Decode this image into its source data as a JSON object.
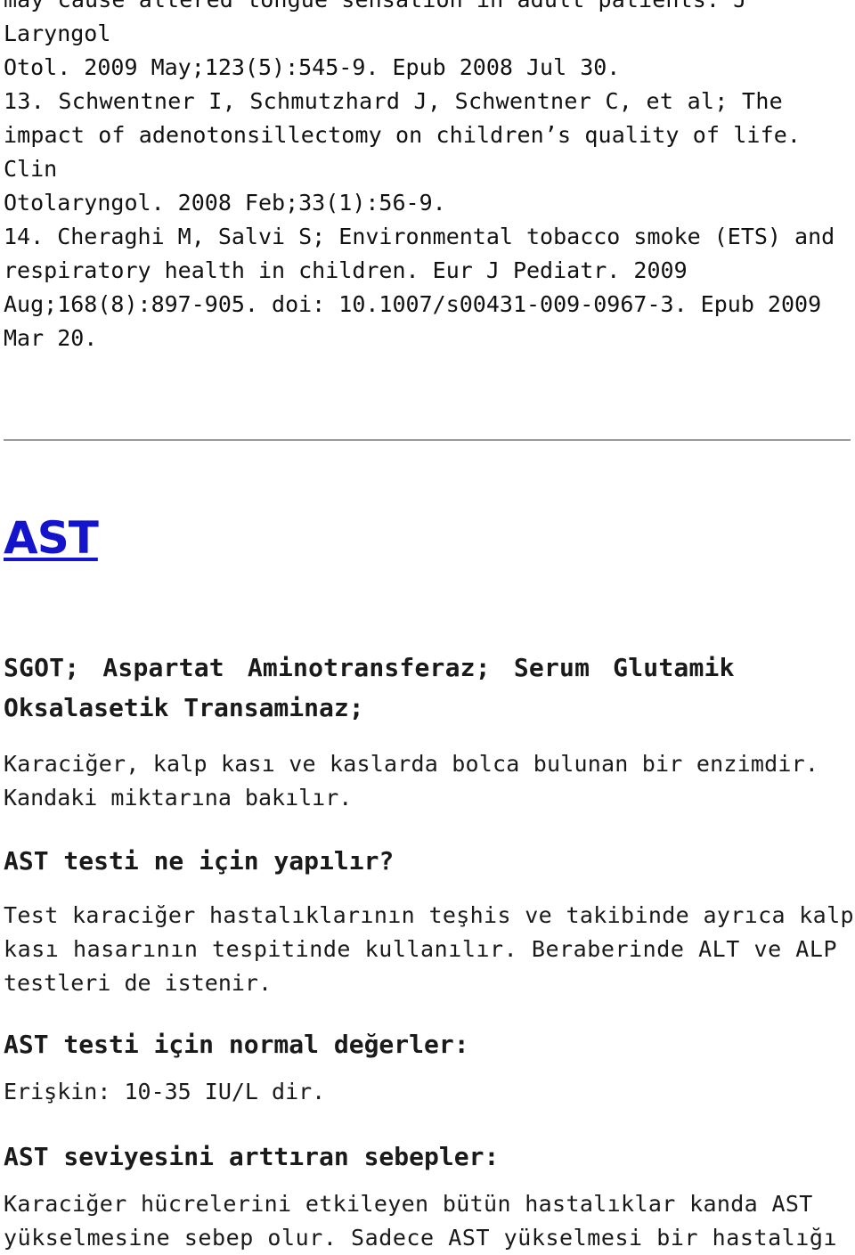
{
  "references": {
    "lines": [
      "may cause altered tongue sensation in adult patients. J",
      "Laryngol",
      "Otol. 2009 May;123(5):545-9. Epub 2008 Jul 30.",
      "13. Schwentner I, Schmutzhard J, Schwentner C, et al; The",
      "impact of adenotonsillectomy on children’s quality of life.",
      "Clin",
      "Otolaryngol. 2008 Feb;33(1):56-9.",
      "14. Cheraghi M, Salvi S; Environmental tobacco smoke (ETS) and",
      "respiratory health in children. Eur J Pediatr. 2009",
      "Aug;168(8):897-905. doi: 10.1007/s00431-009-0967-3. Epub 2009",
      "Mar 20."
    ]
  },
  "article": {
    "title_link": "AST",
    "link_color": "#1414cc",
    "subtitle_line1": "SGOT; Aspartat Aminotransferaz; Serum Glutamik",
    "subtitle_line2": "Oksalasetik Transaminaz;",
    "intro_line1": "Karaciğer, kalp kası ve kaslarda bolca bulunan bir enzimdir.",
    "intro_line2": "Kandaki miktarına bakılır.",
    "sections": [
      {
        "heading": "AST testi ne için yapılır?",
        "lines": [
          "Test karaciğer hastalıklarının teşhis ve takibinde ayrıca kalp",
          "kası hasarının tespitinde kullanılır. Beraberinde ALT ve ALP",
          "testleri de istenir."
        ]
      },
      {
        "heading": "AST testi için normal değerler:",
        "lines": [
          "Erişkin: 10-35 IU/L dir."
        ]
      },
      {
        "heading": "AST seviyesini arttıran sebepler:",
        "lines": [
          "Karaciğer hücrelerini etkileyen bütün hastalıklar kanda AST",
          "yükselmesine sebep olur. Sadece AST yükselmesi bir hastalığı"
        ]
      }
    ]
  }
}
